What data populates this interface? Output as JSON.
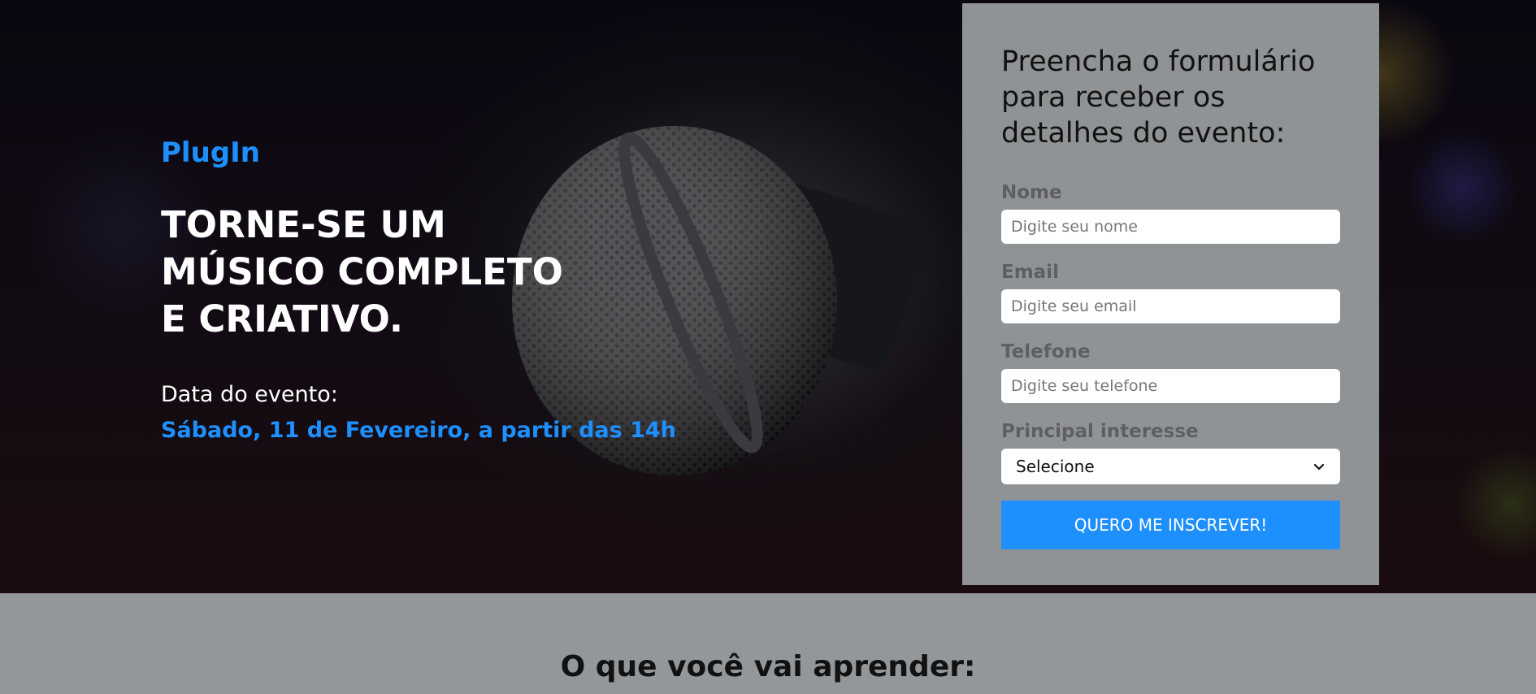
{
  "hero": {
    "brand": "PlugIn",
    "headline_lines": [
      "TORNE-SE UM",
      "MÚSICO COMPLETO",
      "E CRIATIVO."
    ],
    "date_label": "Data do evento:",
    "date_value": "Sábado, 11 de Fevereiro, a partir das 14h"
  },
  "form": {
    "title": "Preencha o formulário para receber os detalhes do evento:",
    "name_label": "Nome",
    "name_placeholder": "Digite seu nome",
    "email_label": "Email",
    "email_placeholder": "Digite seu email",
    "phone_label": "Telefone",
    "phone_placeholder": "Digite seu telefone",
    "interest_label": "Principal interesse",
    "interest_selected": "Selecione",
    "submit_label": "QUERO ME INSCREVER!"
  },
  "learn_section": {
    "title": "O que você vai aprender:"
  },
  "colors": {
    "accent": "#1e8fff",
    "card_bg": "#909396",
    "page_bg": "#93979a"
  },
  "icons": {
    "select_arrow": "chevron-down-icon"
  }
}
